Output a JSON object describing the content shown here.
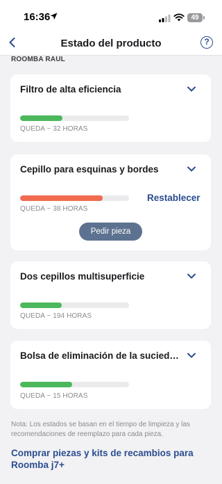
{
  "status_bar": {
    "time": "16:36",
    "battery": "49"
  },
  "header": {
    "title": "Estado del producto",
    "help_label": "?"
  },
  "device": {
    "name": "ROOMBA RAUL"
  },
  "parts": [
    {
      "name": "Filtro de alta eficiencia",
      "remaining": "QUEDA ~ 32 HORAS",
      "level_percent": 39,
      "bar_color": "#4cb85c"
    },
    {
      "name": "Cepillo para esquinas y bordes",
      "remaining": "QUEDA ~ 38 HORAS",
      "level_percent": 76,
      "bar_color": "#f16b50",
      "reset_label": "Restablecer",
      "order_label": "Pedir pieza"
    },
    {
      "name": "Dos cepillos multisuperficie",
      "remaining": "QUEDA ~ 194 HORAS",
      "level_percent": 38,
      "bar_color": "#4cb85c"
    },
    {
      "name": "Bolsa de eliminación de la sucied…",
      "remaining": "QUEDA ~ 15 HORAS",
      "level_percent": 48,
      "bar_color": "#4cb85c"
    }
  ],
  "footnote": "Nota: Los estados se basan en el tiempo de limpieza y las recomendaciones de reemplazo para cada pieza.",
  "shop_link": "Comprar piezas y kits de recambios para Roomba j7+",
  "colors": {
    "accent": "#2b4d8f",
    "background": "#f2f2f4"
  }
}
